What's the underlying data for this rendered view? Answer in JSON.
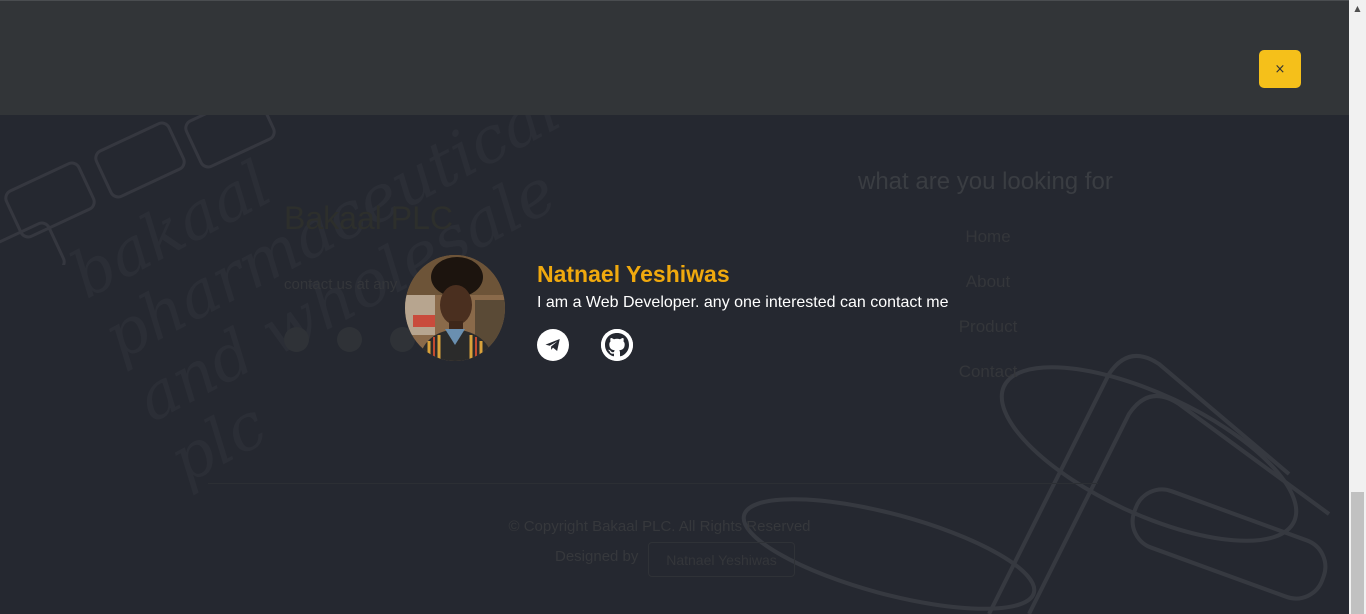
{
  "footer": {
    "company_name": "Bakaal PLC",
    "contact_text": "contact us at any",
    "watermark_lines": [
      "bakaal",
      "pharmaceutical",
      "and wholesale",
      "plc"
    ],
    "social_icons": [
      "telegram-icon",
      "facebook-icon",
      "instagram-icon"
    ],
    "nav_heading": "what are you looking for",
    "nav_items": [
      "Home",
      "About",
      "Product",
      "Contact"
    ],
    "copyright": "© Copyright Bakaal PLC. All Rights Reserved",
    "designed_by_label": "Designed by",
    "designer_name": "Natnael Yeshiwas"
  },
  "modal": {
    "close_label": "×",
    "profile": {
      "name": "Natnael Yeshiwas",
      "description": "I am a Web Developer. any one interested can contact me",
      "socials": [
        "telegram-icon",
        "github-icon"
      ]
    }
  },
  "colors": {
    "accent": "#f5c01a",
    "name_color": "#f0a90e",
    "background": "#24272c",
    "top_bar": "#323538"
  },
  "scrollbar": {
    "up_arrow": "▲"
  }
}
